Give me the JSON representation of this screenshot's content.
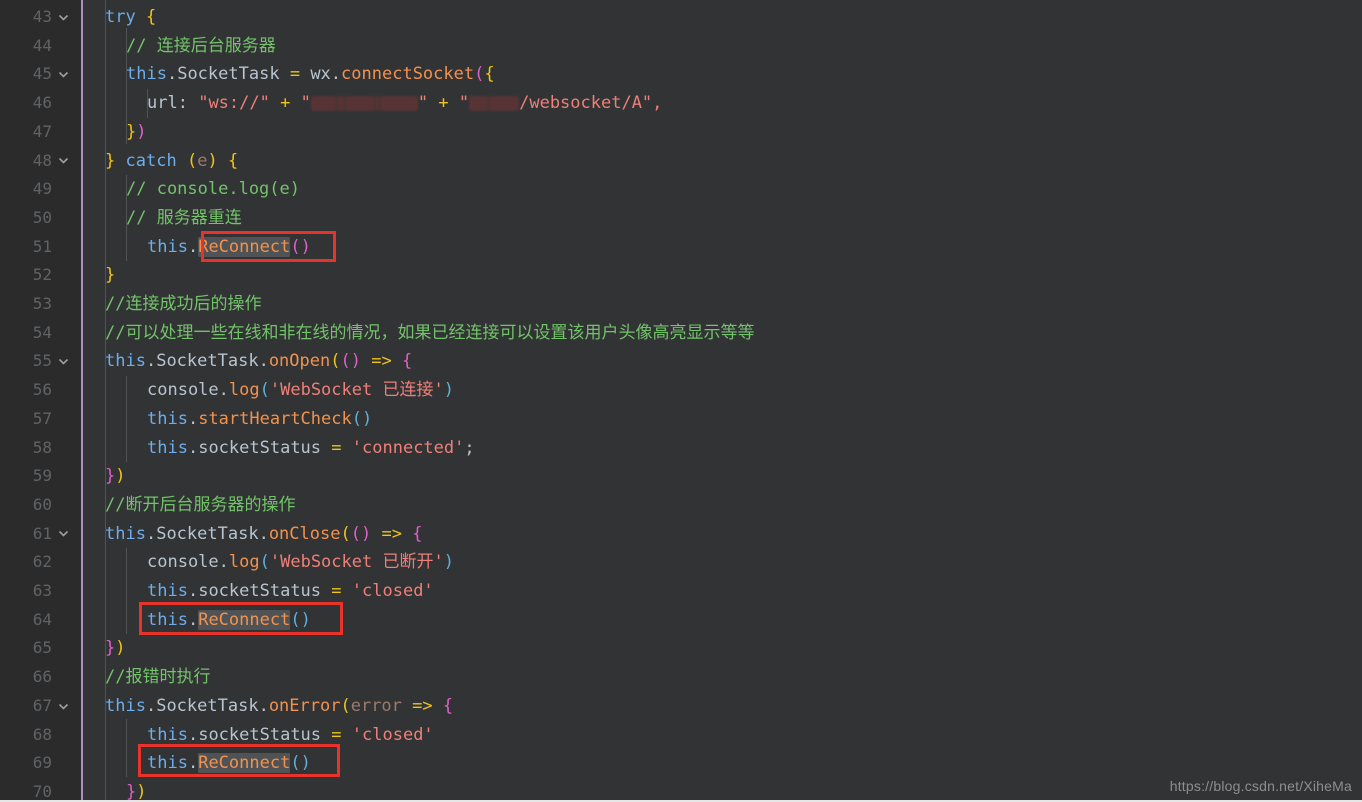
{
  "editor": {
    "theme_name": "darcula",
    "background": "#313335",
    "gutter_background": "#2b2b2b",
    "line_number_color": "#606366",
    "gutter_rule_color": "#b18cc2",
    "annotation_color": "#e8332a",
    "selection_color": "#4f5355",
    "first_visible_line": 43,
    "last_visible_line": 70,
    "line_height_px": 28.7,
    "fold_icon": "chevron-down-icon",
    "foldable_lines": [
      43,
      45,
      48,
      55,
      61,
      67
    ],
    "line_numbers": [
      43,
      44,
      45,
      46,
      47,
      48,
      49,
      50,
      51,
      52,
      53,
      54,
      55,
      56,
      57,
      58,
      59,
      60,
      61,
      62,
      63,
      64,
      65,
      66,
      67,
      68,
      69,
      70
    ],
    "lines": [
      {
        "n": 43,
        "text": "  try {"
      },
      {
        "n": 44,
        "text": "    // 连接后台服务器"
      },
      {
        "n": 45,
        "text": "    this.SocketTask = wx.connectSocket({"
      },
      {
        "n": 46,
        "text": "      url: \"ws://\" + \"[redacted]\" + \"[redacted]/websocket/A\","
      },
      {
        "n": 47,
        "text": "    })"
      },
      {
        "n": 48,
        "text": "  } catch (e) {"
      },
      {
        "n": 49,
        "text": "    // console.log(e)"
      },
      {
        "n": 50,
        "text": "    // 服务器重连"
      },
      {
        "n": 51,
        "text": "    this.ReConnect()"
      },
      {
        "n": 52,
        "text": "  }"
      },
      {
        "n": 53,
        "text": "  //连接成功后的操作"
      },
      {
        "n": 54,
        "text": "  //可以处理一些在线和非在线的情况，如果已经连接可以设置该用户头像高亮显示等等"
      },
      {
        "n": 55,
        "text": "  this.SocketTask.onOpen(() => {"
      },
      {
        "n": 56,
        "text": "    console.log('WebSocket 已连接')"
      },
      {
        "n": 57,
        "text": "    this.startHeartCheck()"
      },
      {
        "n": 58,
        "text": "    this.socketStatus = 'connected';"
      },
      {
        "n": 59,
        "text": "  })"
      },
      {
        "n": 60,
        "text": "  //断开后台服务器的操作"
      },
      {
        "n": 61,
        "text": "  this.SocketTask.onClose(() => {"
      },
      {
        "n": 62,
        "text": "    console.log('WebSocket 已断开')"
      },
      {
        "n": 63,
        "text": "    this.socketStatus = 'closed'"
      },
      {
        "n": 64,
        "text": "    this.ReConnect()"
      },
      {
        "n": 65,
        "text": "  })"
      },
      {
        "n": 66,
        "text": "  //报错时执行"
      },
      {
        "n": 67,
        "text": "  this.SocketTask.onError(error => {"
      },
      {
        "n": 68,
        "text": "    this.socketStatus = 'closed'"
      },
      {
        "n": 69,
        "text": "    this.ReConnect()"
      },
      {
        "n": 70,
        "text": "  })"
      }
    ],
    "tokens": {
      "kw_try": "try",
      "kw_catch": "catch",
      "this": "this",
      "dot": ".",
      "socket_task": "SocketTask",
      "wx": "wx",
      "connect_socket": "connectSocket",
      "url_key": "url:",
      "ws_proto": "\"ws://\"",
      "plus": "+",
      "ws_path": "/websocket/A\",",
      "quote": "\"",
      "console": "console",
      "log": "log",
      "on_open": "onOpen",
      "on_close": "onClose",
      "on_error": "onError",
      "start_heart_check": "startHeartCheck",
      "socket_status": "socketStatus",
      "reconnect": "ReConnect",
      "error_param": "error",
      "arrow": "=>",
      "equals": "=",
      "paren_open": "(",
      "paren_close": ")",
      "paren_pair": "()",
      "brace_open": "{",
      "brace_close": "}",
      "obj_open": "({",
      "obj_close": "})",
      "semicolon": ";",
      "str_connected": "'connected'",
      "str_closed": "'closed'",
      "str_ws_connected": "'WebSocket 已连接'",
      "str_ws_closed": "'WebSocket 已断开'",
      "cmt_connect_server": "// 连接后台服务器",
      "cmt_console_log": "// console.log(e)",
      "cmt_server_reconnect": "// 服务器重连",
      "cmt_on_success": "//连接成功后的操作",
      "cmt_online_handling": "//可以处理一些在线和非在线的情况，如果已经连接可以设置该用户头像高亮显示等等",
      "cmt_on_disconnect": "//断开后台服务器的操作",
      "cmt_on_error": "//报错时执行",
      "e_param": "e"
    },
    "annotations": [
      {
        "target_line": 51,
        "label": "highlight-box-reconnect-catch"
      },
      {
        "target_line": 64,
        "label": "highlight-box-reconnect-onclose"
      },
      {
        "target_line": 69,
        "label": "highlight-box-reconnect-onerror"
      }
    ]
  },
  "watermark": {
    "text": "https://blog.csdn.net/XiheMa"
  }
}
